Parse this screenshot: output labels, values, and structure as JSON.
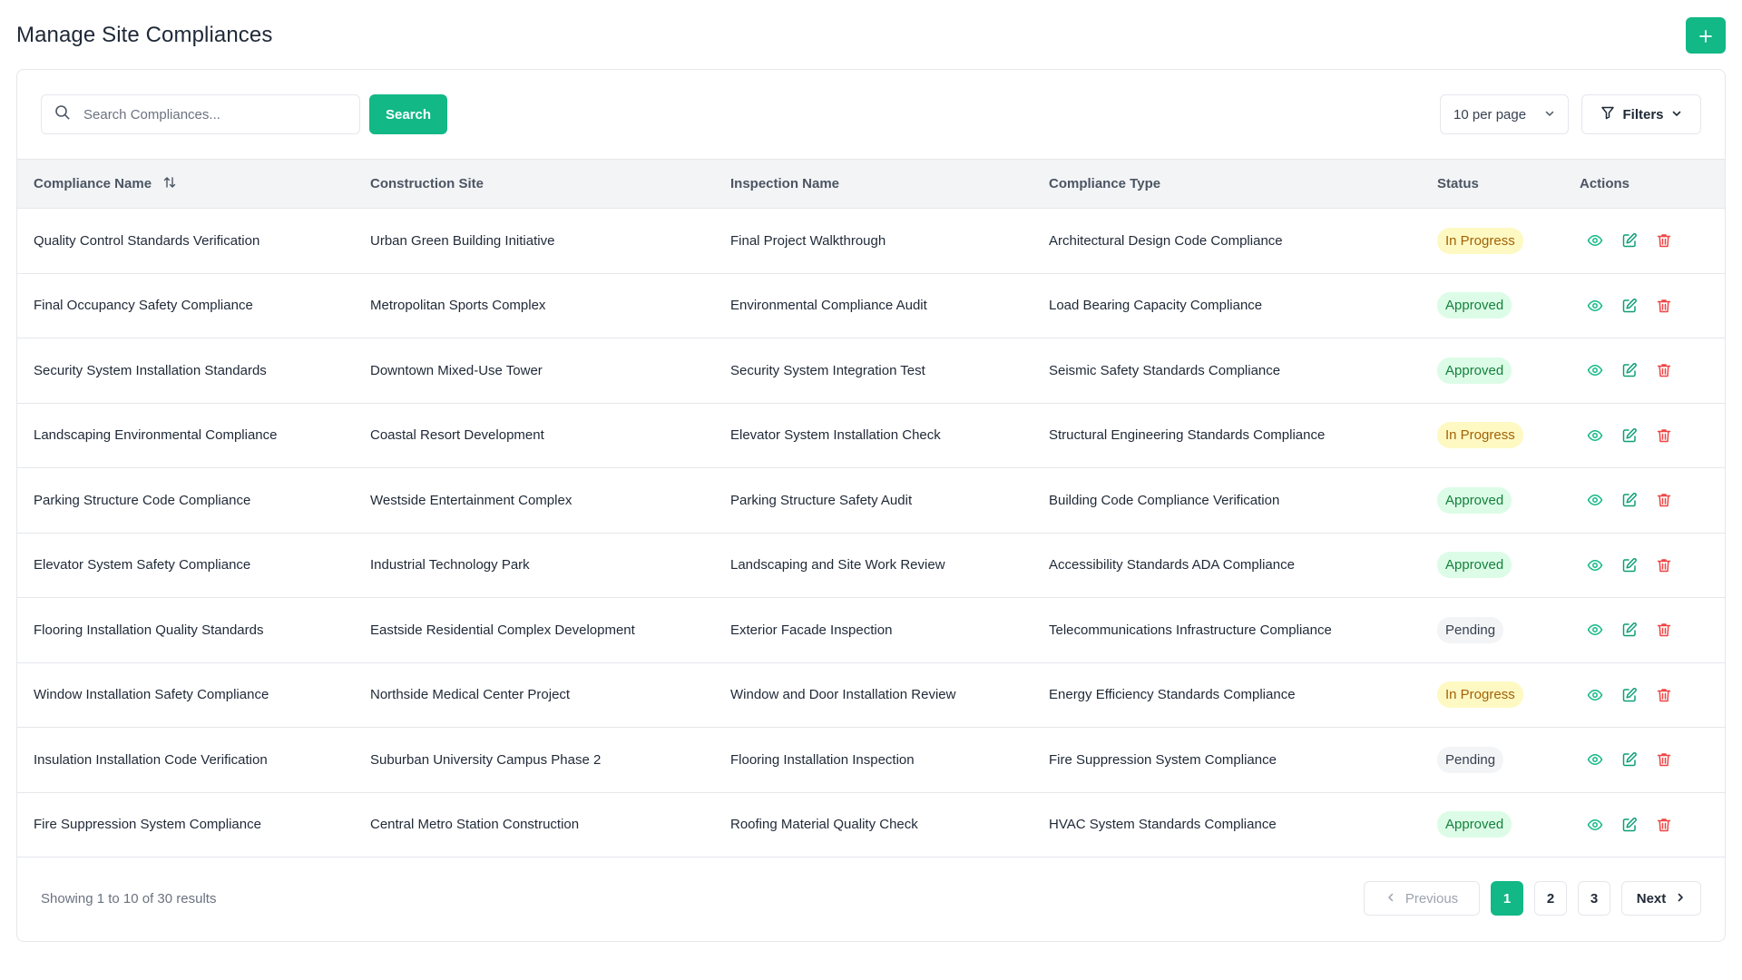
{
  "page": {
    "title": "Manage Site Compliances",
    "add_icon": "plus-icon"
  },
  "toolbar": {
    "search_placeholder": "Search Compliances...",
    "search_value": "",
    "search_label": "Search",
    "per_page": "10 per page",
    "filters_label": "Filters"
  },
  "table": {
    "columns": [
      "Compliance Name",
      "Construction Site",
      "Inspection Name",
      "Compliance Type",
      "Status",
      "Actions"
    ],
    "rows": [
      {
        "name": "Quality Control Standards Verification",
        "site": "Urban Green Building Initiative",
        "inspection": "Final Project Walkthrough",
        "type": "Architectural Design Code Compliance",
        "status": "In Progress",
        "status_kind": "inprogress"
      },
      {
        "name": "Final Occupancy Safety Compliance",
        "site": "Metropolitan Sports Complex",
        "inspection": "Environmental Compliance Audit",
        "type": "Load Bearing Capacity Compliance",
        "status": "Approved",
        "status_kind": "approved"
      },
      {
        "name": "Security System Installation Standards",
        "site": "Downtown Mixed-Use Tower",
        "inspection": "Security System Integration Test",
        "type": "Seismic Safety Standards Compliance",
        "status": "Approved",
        "status_kind": "approved"
      },
      {
        "name": "Landscaping Environmental Compliance",
        "site": "Coastal Resort Development",
        "inspection": "Elevator System Installation Check",
        "type": "Structural Engineering Standards Compliance",
        "status": "In Progress",
        "status_kind": "inprogress"
      },
      {
        "name": "Parking Structure Code Compliance",
        "site": "Westside Entertainment Complex",
        "inspection": "Parking Structure Safety Audit",
        "type": "Building Code Compliance Verification",
        "status": "Approved",
        "status_kind": "approved"
      },
      {
        "name": "Elevator System Safety Compliance",
        "site": "Industrial Technology Park",
        "inspection": "Landscaping and Site Work Review",
        "type": "Accessibility Standards ADA Compliance",
        "status": "Approved",
        "status_kind": "approved"
      },
      {
        "name": "Flooring Installation Quality Standards",
        "site": "Eastside Residential Complex Development",
        "inspection": "Exterior Facade Inspection",
        "type": "Telecommunications Infrastructure Compliance",
        "status": "Pending",
        "status_kind": "pending"
      },
      {
        "name": "Window Installation Safety Compliance",
        "site": "Northside Medical Center Project",
        "inspection": "Window and Door Installation Review",
        "type": "Energy Efficiency Standards Compliance",
        "status": "In Progress",
        "status_kind": "inprogress"
      },
      {
        "name": "Insulation Installation Code Verification",
        "site": "Suburban University Campus Phase 2",
        "inspection": "Flooring Installation Inspection",
        "type": "Fire Suppression System Compliance",
        "status": "Pending",
        "status_kind": "pending"
      },
      {
        "name": "Fire Suppression System Compliance",
        "site": "Central Metro Station Construction",
        "inspection": "Roofing Material Quality Check",
        "type": "HVAC System Standards Compliance",
        "status": "Approved",
        "status_kind": "approved"
      }
    ]
  },
  "footer": {
    "showing": "Showing 1 to 10 of 30 results",
    "previous": "Previous",
    "next": "Next",
    "pages": [
      "1",
      "2",
      "3"
    ],
    "current_page": "1"
  },
  "colors": {
    "accent": "#12b886",
    "view_icon": "#12b886",
    "edit_icon": "#0f9f76",
    "delete_icon": "#ef4444"
  }
}
